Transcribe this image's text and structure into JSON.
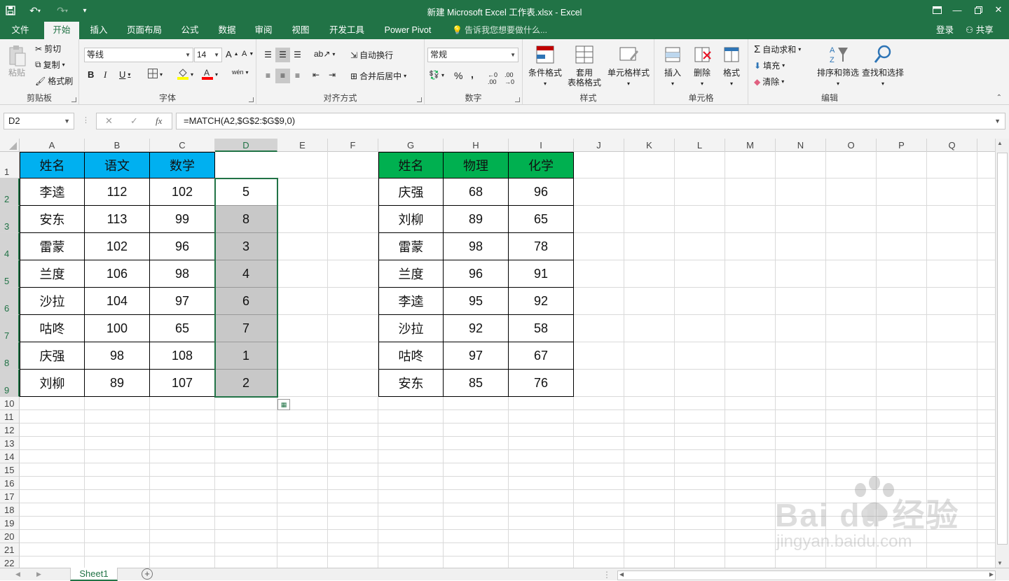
{
  "window": {
    "title": "新建 Microsoft Excel 工作表.xlsx - Excel"
  },
  "tabs": [
    {
      "label": "文件",
      "active": false
    },
    {
      "label": "开始",
      "active": true
    },
    {
      "label": "插入",
      "active": false
    },
    {
      "label": "页面布局",
      "active": false
    },
    {
      "label": "公式",
      "active": false
    },
    {
      "label": "数据",
      "active": false
    },
    {
      "label": "审阅",
      "active": false
    },
    {
      "label": "视图",
      "active": false
    },
    {
      "label": "开发工具",
      "active": false
    },
    {
      "label": "Power Pivot",
      "active": false
    }
  ],
  "tell_me": "告诉我您想要做什么...",
  "account": {
    "signin": "登录",
    "share": "共享"
  },
  "ribbon": {
    "clipboard": {
      "label": "剪贴板",
      "paste": "粘贴",
      "cut": "剪切",
      "copy": "复制",
      "format_painter": "格式刷"
    },
    "font": {
      "label": "字体",
      "font_name": "等线",
      "font_size": "14",
      "bold": "B",
      "italic": "I",
      "underline": "U",
      "phonetic": "wén"
    },
    "alignment": {
      "label": "对齐方式",
      "wrap": "自动换行",
      "merge": "合并后居中"
    },
    "number": {
      "label": "数字",
      "format": "常规",
      "percent": "%",
      "comma": ","
    },
    "styles": {
      "label": "样式",
      "conditional": "条件格式",
      "table_line1": "套用",
      "table_line2": "表格格式",
      "cell_styles": "单元格样式"
    },
    "cells": {
      "label": "单元格",
      "insert": "插入",
      "delete": "删除",
      "format": "格式"
    },
    "editing": {
      "label": "编辑",
      "autosum": "自动求和",
      "fill": "填充",
      "clear": "清除",
      "sort": "排序和筛选",
      "find": "查找和选择"
    }
  },
  "formula_bar": {
    "name_box": "D2",
    "formula": "=MATCH(A2,$G$2:$G$9,0)",
    "fx": "fx"
  },
  "columns": [
    "A",
    "B",
    "C",
    "D",
    "E",
    "F",
    "G",
    "H",
    "I",
    "J",
    "K",
    "L",
    "M",
    "N",
    "O",
    "P",
    "Q"
  ],
  "rows": [
    "1",
    "2",
    "3",
    "4",
    "5",
    "6",
    "7",
    "8",
    "9",
    "10",
    "11",
    "12",
    "13",
    "14",
    "15",
    "16",
    "17",
    "18",
    "19",
    "20",
    "21",
    "22"
  ],
  "selection": {
    "column": "D",
    "rows_from": 2,
    "rows_to": 9
  },
  "colors": {
    "excel_green": "#217346",
    "left_header": "#00b0f0",
    "right_header": "#00b050",
    "selection_fill": "#c8c8c8"
  },
  "table_left": {
    "headers": [
      "姓名",
      "语文",
      "数学",
      ""
    ],
    "rows": [
      [
        "李逵",
        "112",
        "102",
        "5"
      ],
      [
        "安东",
        "113",
        "99",
        "8"
      ],
      [
        "雷蒙",
        "102",
        "96",
        "3"
      ],
      [
        "兰度",
        "106",
        "98",
        "4"
      ],
      [
        "沙拉",
        "104",
        "97",
        "6"
      ],
      [
        "咕咚",
        "100",
        "65",
        "7"
      ],
      [
        "庆强",
        "98",
        "108",
        "1"
      ],
      [
        "刘柳",
        "89",
        "107",
        "2"
      ]
    ]
  },
  "table_right": {
    "headers": [
      "姓名",
      "物理",
      "化学"
    ],
    "rows": [
      [
        "庆强",
        "68",
        "96"
      ],
      [
        "刘柳",
        "89",
        "65"
      ],
      [
        "雷蒙",
        "98",
        "78"
      ],
      [
        "兰度",
        "96",
        "91"
      ],
      [
        "李逵",
        "95",
        "92"
      ],
      [
        "沙拉",
        "92",
        "58"
      ],
      [
        "咕咚",
        "97",
        "67"
      ],
      [
        "安东",
        "85",
        "76"
      ]
    ]
  },
  "sheet_tabs": [
    "Sheet1"
  ],
  "watermark": {
    "brand": "Bai du 经验",
    "url": "jingyan.baidu.com"
  }
}
